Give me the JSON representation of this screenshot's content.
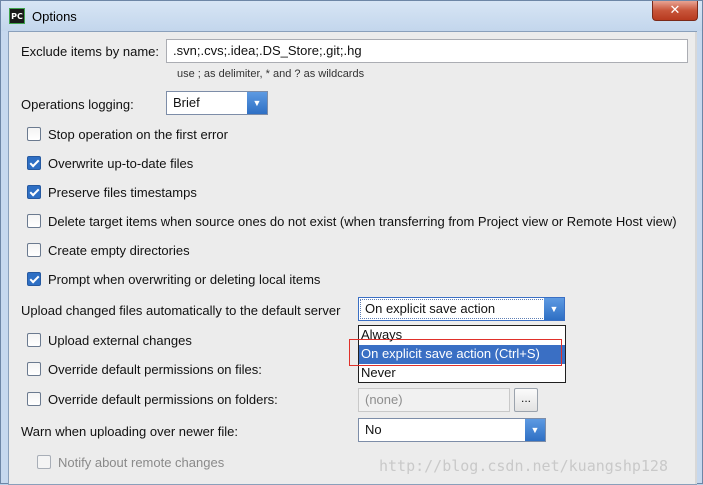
{
  "window": {
    "title": "Options",
    "app_icon_text": "PC",
    "close_glyph": "✕"
  },
  "exclude": {
    "label": "Exclude items by name:",
    "value": ".svn;.cvs;.idea;.DS_Store;.git;.hg",
    "hint": "use ; as delimiter, * and ? as wildcards"
  },
  "operations_logging": {
    "label": "Operations logging:",
    "value": "Brief"
  },
  "checkboxes": [
    {
      "label": "Stop operation on the first error",
      "checked": false
    },
    {
      "label": "Overwrite up-to-date files",
      "checked": true
    },
    {
      "label": "Preserve files timestamps",
      "checked": true
    },
    {
      "label": "Delete target items when source ones do not exist (when transferring from Project view or Remote Host view)",
      "checked": false
    },
    {
      "label": "Create empty directories",
      "checked": false
    },
    {
      "label": "Prompt when overwriting or deleting local items",
      "checked": true
    }
  ],
  "upload": {
    "label": "Upload changed files automatically to the default server",
    "value": "On explicit save action (Ctrl+S)",
    "options": [
      "Always",
      "On explicit save action (Ctrl+S)",
      "Never"
    ],
    "selected_index": 1
  },
  "upload_external": {
    "label": "Upload external changes",
    "checked": false
  },
  "override_files": {
    "label": "Override default permissions on files:",
    "checked": false
  },
  "override_folders": {
    "label": "Override default permissions on folders:",
    "checked": false,
    "value": "(none)",
    "button": "..."
  },
  "warn": {
    "label": "Warn when uploading over newer file:",
    "value": "No"
  },
  "notify": {
    "label": "Notify about remote changes",
    "checked": false,
    "enabled": false
  },
  "watermark": "http://blog.csdn.net/kuangshp128"
}
